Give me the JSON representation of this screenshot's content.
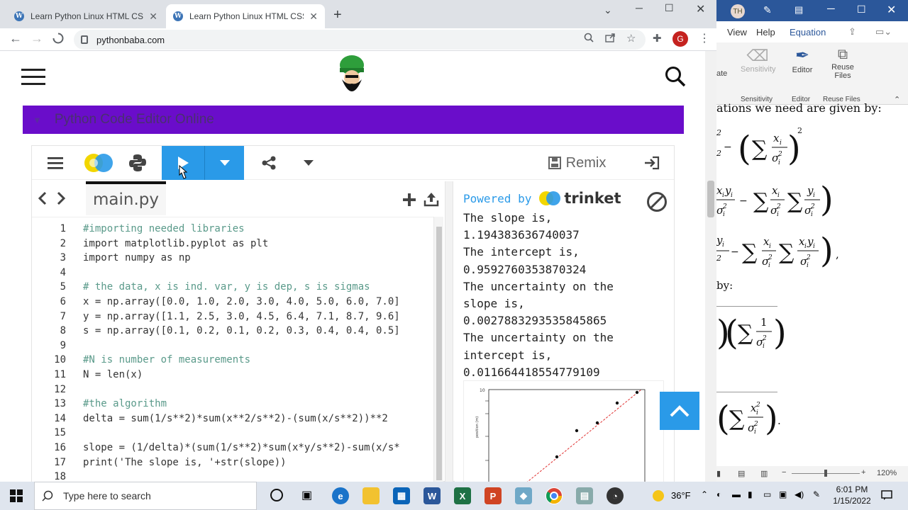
{
  "browser": {
    "tabs": [
      {
        "title": "Learn Python Linux HTML CSS JS"
      },
      {
        "title": "Learn Python Linux HTML CSS JS"
      }
    ],
    "url": "pythonbaba.com",
    "profile_initial": "G"
  },
  "site": {
    "banner_title": "Python Code Editor Online"
  },
  "trinket": {
    "remix_label": "Remix",
    "file_tab": "main.py",
    "powered_by": "Powered by",
    "brand": "trinket",
    "code_lines": [
      {
        "n": "1",
        "text": "#importing needed libraries"
      },
      {
        "n": "2",
        "text": "import matplotlib.pyplot as plt"
      },
      {
        "n": "3",
        "text": "import numpy as np"
      },
      {
        "n": "4",
        "text": ""
      },
      {
        "n": "5",
        "text": "# the data, x is ind. var, y is dep, s is sigmas"
      },
      {
        "n": "6",
        "text": "x = np.array([0.0, 1.0, 2.0, 3.0, 4.0, 5.0, 6.0, 7.0]"
      },
      {
        "n": "7",
        "text": "y = np.array([1.1, 2.5, 3.0, 4.5, 6.4, 7.1, 8.7, 9.6]"
      },
      {
        "n": "8",
        "text": "s = np.array([0.1, 0.2, 0.1, 0.2, 0.3, 0.4, 0.4, 0.5]"
      },
      {
        "n": "9",
        "text": ""
      },
      {
        "n": "10",
        "text": "#N is number of measurements"
      },
      {
        "n": "11",
        "text": "N = len(x)"
      },
      {
        "n": "12",
        "text": ""
      },
      {
        "n": "13",
        "text": "#the algorithm"
      },
      {
        "n": "14",
        "text": "delta = sum(1/s**2)*sum(x**2/s**2)-(sum(x/s**2))**2"
      },
      {
        "n": "15",
        "text": ""
      },
      {
        "n": "16",
        "text": "slope = (1/delta)*(sum(1/s**2)*sum(x*y/s**2)-sum(x/s*"
      },
      {
        "n": "17",
        "text": "print('The slope is, '+str(slope))"
      },
      {
        "n": "18",
        "text": ""
      }
    ],
    "output_lines": [
      "The slope is,",
      "1.194383636740037",
      "The intercept is,",
      "0.9592760353870324",
      "The uncertainty on the",
      "slope is,",
      "0.0027883293535845865",
      "The uncertainty on the",
      "intercept is,",
      "0.011664418554779109"
    ],
    "plot_ylabel": "position (m)",
    "plot_ytick_top": "10"
  },
  "word": {
    "menu": [
      "View",
      "Help",
      "Equation"
    ],
    "ribbon": {
      "groups": [
        "Sensitivity",
        "Editor",
        "Reuse Files"
      ],
      "buttons": [
        "Sensitivity",
        "Editor",
        "Reuse Files"
      ],
      "partial": "ate"
    },
    "doc_heading": "ations we need are given by:",
    "doc_by": "by:",
    "zoom": "120%"
  },
  "taskbar": {
    "search_placeholder": "Type here to search",
    "weather": "36°F",
    "time": "6:01 PM",
    "date": "1/15/2022"
  },
  "colors": {
    "banner": "#6a0dca",
    "run_button": "#2a9ae8",
    "word_blue": "#2b579a"
  }
}
